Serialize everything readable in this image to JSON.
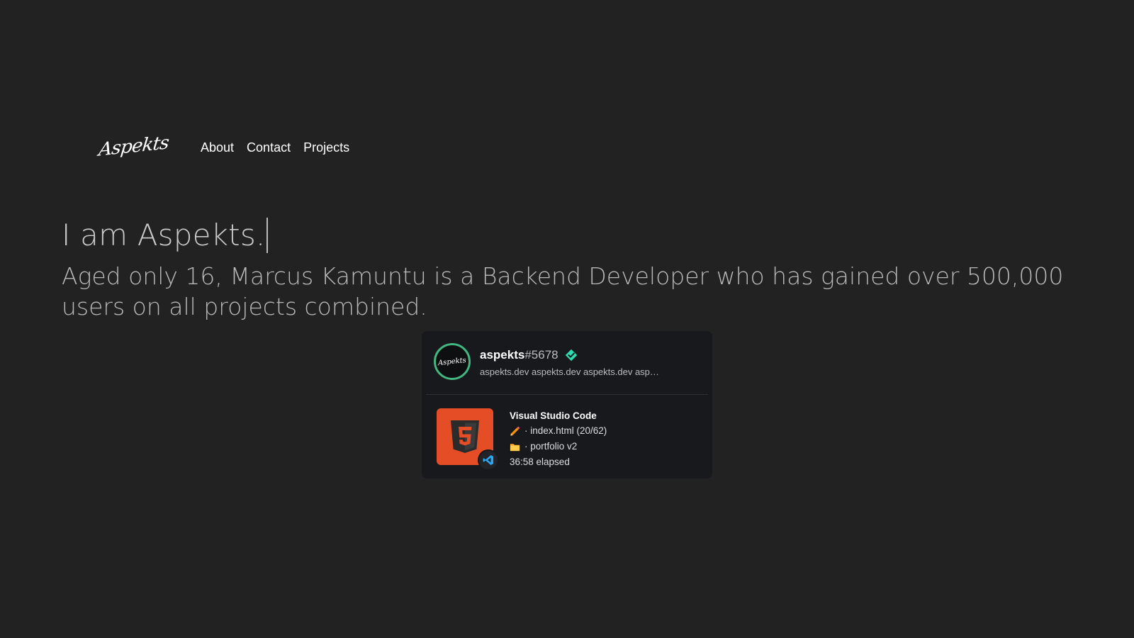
{
  "header": {
    "logo_text": "Aspekts",
    "nav": [
      {
        "label": "About"
      },
      {
        "label": "Contact"
      },
      {
        "label": "Projects"
      }
    ]
  },
  "hero": {
    "title": "I am Aspekts.",
    "subtitle": "Aged only 16, Marcus Kamuntu is a Backend Developer who has gained over 500,000 users on all projects combined."
  },
  "presence_card": {
    "avatar_text": "Aspekts",
    "avatar_ring_color": "#43b581",
    "username": "aspekts",
    "discriminator": "#5678",
    "badge_icon": "verified-badge-icon",
    "badge_color": "#2ddbb0",
    "custom_status": "aspekts.dev aspekts.dev aspekts.dev aspekts.dev aspekts.dev",
    "activity": {
      "app_name": "Visual Studio Code",
      "large_icon": "html5-icon",
      "large_icon_color": "#e44d26",
      "small_icon": "vscode-icon",
      "file_prefix_icon": "pencil-icon",
      "file_line": "· index.html (20/62)",
      "workspace_prefix_icon": "folder-icon",
      "workspace_line": "· portfolio v2",
      "elapsed": "36:58 elapsed"
    }
  }
}
